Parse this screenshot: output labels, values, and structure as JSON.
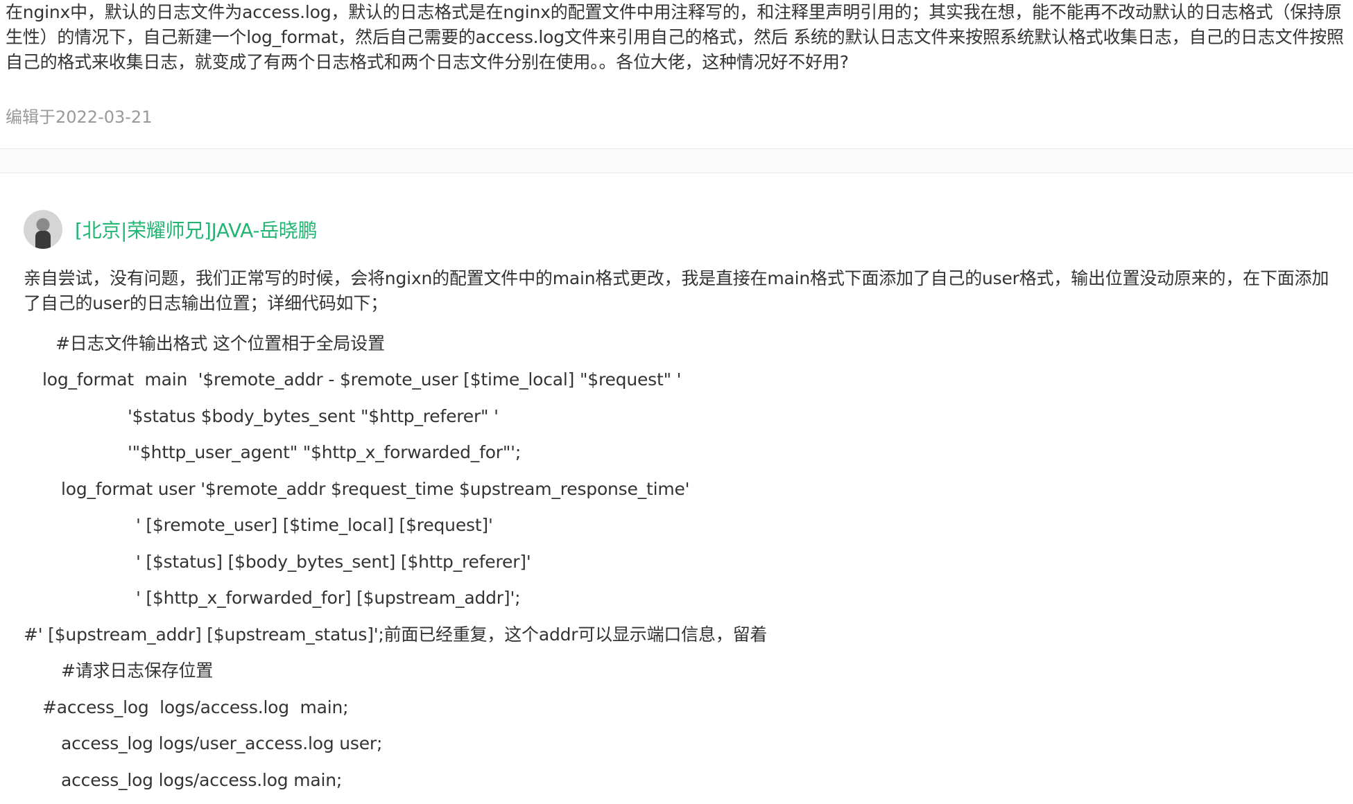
{
  "question": {
    "body": "在nginx中，默认的日志文件为access.log，默认的日志格式是在nginx的配置文件中用注释写的，和注释里声明引用的；其实我在想，能不能再不改动默认的日志格式（保持原生性）的情况下，自己新建一个log_format，然后自己需要的access.log文件来引用自己的格式，然后 系统的默认日志文件来按照系统默认格式收集日志，自己的日志文件按照自己的格式来收集日志，就变成了有两个日志格式和两个日志文件分别在使用。。各位大佬，这种情况好不好用?",
    "edited": "编辑于2022-03-21"
  },
  "answer": {
    "author": "[北京|荣耀师兄]JAVA-岳晓鹏",
    "intro": "亲自尝试，没有问题，我们正常写的时候，会将ngixn的配置文件中的main格式更改，我是直接在main格式下面添加了自己的user格式，输出位置没动原来的，在下面添加了自己的user的日志输出位置；详细代码如下；",
    "lines": [
      "#日志文件输出格式 这个位置相于全局设置",
      "log_format  main  '$remote_addr - $remote_user [$time_local] \"$request\" '",
      "'$status $body_bytes_sent \"$http_referer\" '",
      "'\"$http_user_agent\" \"$http_x_forwarded_for\"';",
      "log_format user '$remote_addr $request_time $upstream_response_time'",
      "' [$remote_user] [$time_local] [$request]'",
      "' [$status] [$body_bytes_sent] [$http_referer]'",
      "' [$http_x_forwarded_for] [$upstream_addr]';",
      "#' [$upstream_addr] [$upstream_status]';前面已经重复，这个addr可以显示端口信息，留着",
      "#请求日志保存位置",
      "#access_log  logs/access.log  main;",
      "access_log logs/user_access.log user;",
      "access_log logs/access.log main;"
    ]
  },
  "colors": {
    "text": "#333333",
    "muted": "#999999",
    "author_link": "#22b573"
  }
}
